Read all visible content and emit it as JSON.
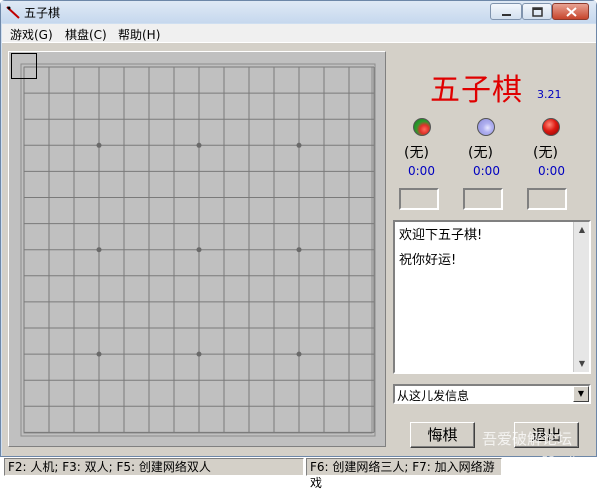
{
  "window": {
    "title": "五子棋"
  },
  "menu": {
    "items": [
      "游戏(G)",
      "棋盘(C)",
      "帮助(H)"
    ]
  },
  "game": {
    "title": "五子棋",
    "version": "3.21"
  },
  "players": [
    {
      "name": "(无)",
      "time": "0:00",
      "stone_color": "green-red"
    },
    {
      "name": "(无)",
      "time": "0:00",
      "stone_color": "blue"
    },
    {
      "name": "(无)",
      "time": "0:00",
      "stone_color": "red"
    }
  ],
  "messages": [
    "欢迎下五子棋!",
    "祝你好运!"
  ],
  "send": {
    "placeholder": "从这儿发信息"
  },
  "buttons": {
    "undo": "悔棋",
    "quit": "退出"
  },
  "status": {
    "left": "F2: 人机; F3: 双人; F5: 创建网络双人",
    "right": "F6: 创建网络三人; F7: 加入网络游戏"
  },
  "watermark": {
    "text": "吾爱破解论坛",
    "url": "www.52pojie.cn"
  },
  "colors": {
    "title_red": "#e00000",
    "time_blue": "#0000c0",
    "board": "#c0c0c0"
  }
}
